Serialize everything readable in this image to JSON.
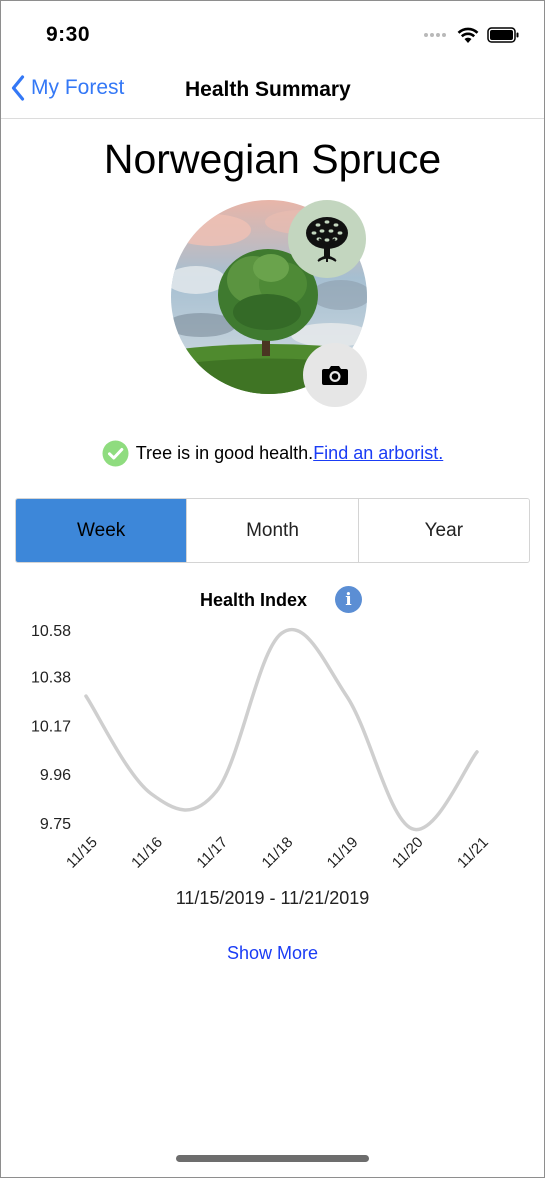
{
  "status_bar": {
    "time": "9:30"
  },
  "nav": {
    "back_label": "My Forest",
    "title": "Health Summary"
  },
  "tree": {
    "name": "Norwegian Spruce"
  },
  "health": {
    "status_text": "Tree is in good health.",
    "link_text": "Find an arborist."
  },
  "tabs": [
    {
      "label": "Week",
      "selected": true
    },
    {
      "label": "Month",
      "selected": false
    },
    {
      "label": "Year",
      "selected": false
    }
  ],
  "chart_title": "Health Index",
  "info_glyph": "i",
  "chart_data": {
    "type": "line",
    "title": "Health Index",
    "categories": [
      "11/15",
      "11/16",
      "11/17",
      "11/18",
      "11/19",
      "11/20",
      "11/21"
    ],
    "values": [
      10.3,
      9.88,
      9.89,
      10.57,
      10.3,
      9.73,
      10.06
    ],
    "yticks": [
      10.58,
      10.38,
      10.17,
      9.96,
      9.75
    ],
    "ylim": [
      9.75,
      10.58
    ],
    "smooth": true,
    "grid": false,
    "line_color": "#cfcfcf"
  },
  "date_range": "11/15/2019 - 11/21/2019",
  "show_more": "Show More"
}
